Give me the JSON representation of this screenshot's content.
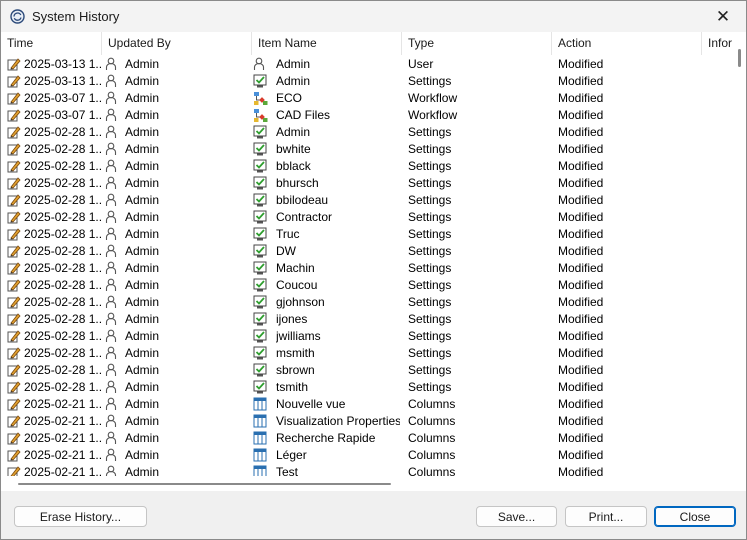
{
  "window": {
    "title": "System History"
  },
  "columns": [
    "Time",
    "Updated By",
    "Item Name",
    "Type",
    "Action",
    "Infor"
  ],
  "rows": [
    {
      "time": "2025-03-13 1...",
      "user": "Admin",
      "item": "Admin",
      "item_icon": "user",
      "type": "User",
      "action": "Modified"
    },
    {
      "time": "2025-03-13 1...",
      "user": "Admin",
      "item": "Admin",
      "item_icon": "settings",
      "type": "Settings",
      "action": "Modified"
    },
    {
      "time": "2025-03-07 1...",
      "user": "Admin",
      "item": "ECO",
      "item_icon": "workflow",
      "type": "Workflow",
      "action": "Modified"
    },
    {
      "time": "2025-03-07 1...",
      "user": "Admin",
      "item": "CAD Files",
      "item_icon": "workflow",
      "type": "Workflow",
      "action": "Modified"
    },
    {
      "time": "2025-02-28 1...",
      "user": "Admin",
      "item": "Admin",
      "item_icon": "settings",
      "type": "Settings",
      "action": "Modified"
    },
    {
      "time": "2025-02-28 1...",
      "user": "Admin",
      "item": "bwhite",
      "item_icon": "settings",
      "type": "Settings",
      "action": "Modified"
    },
    {
      "time": "2025-02-28 1...",
      "user": "Admin",
      "item": "bblack",
      "item_icon": "settings",
      "type": "Settings",
      "action": "Modified"
    },
    {
      "time": "2025-02-28 1...",
      "user": "Admin",
      "item": "bhursch",
      "item_icon": "settings",
      "type": "Settings",
      "action": "Modified"
    },
    {
      "time": "2025-02-28 1...",
      "user": "Admin",
      "item": "bbilodeau",
      "item_icon": "settings",
      "type": "Settings",
      "action": "Modified"
    },
    {
      "time": "2025-02-28 1...",
      "user": "Admin",
      "item": "Contractor",
      "item_icon": "settings",
      "type": "Settings",
      "action": "Modified"
    },
    {
      "time": "2025-02-28 1...",
      "user": "Admin",
      "item": "Truc",
      "item_icon": "settings",
      "type": "Settings",
      "action": "Modified"
    },
    {
      "time": "2025-02-28 1...",
      "user": "Admin",
      "item": "DW",
      "item_icon": "settings",
      "type": "Settings",
      "action": "Modified"
    },
    {
      "time": "2025-02-28 1...",
      "user": "Admin",
      "item": "Machin",
      "item_icon": "settings",
      "type": "Settings",
      "action": "Modified"
    },
    {
      "time": "2025-02-28 1...",
      "user": "Admin",
      "item": "Coucou",
      "item_icon": "settings",
      "type": "Settings",
      "action": "Modified"
    },
    {
      "time": "2025-02-28 1...",
      "user": "Admin",
      "item": "gjohnson",
      "item_icon": "settings",
      "type": "Settings",
      "action": "Modified"
    },
    {
      "time": "2025-02-28 1...",
      "user": "Admin",
      "item": "ijones",
      "item_icon": "settings",
      "type": "Settings",
      "action": "Modified"
    },
    {
      "time": "2025-02-28 1...",
      "user": "Admin",
      "item": "jwilliams",
      "item_icon": "settings",
      "type": "Settings",
      "action": "Modified"
    },
    {
      "time": "2025-02-28 1...",
      "user": "Admin",
      "item": "msmith",
      "item_icon": "settings",
      "type": "Settings",
      "action": "Modified"
    },
    {
      "time": "2025-02-28 1...",
      "user": "Admin",
      "item": "sbrown",
      "item_icon": "settings",
      "type": "Settings",
      "action": "Modified"
    },
    {
      "time": "2025-02-28 1...",
      "user": "Admin",
      "item": "tsmith",
      "item_icon": "settings",
      "type": "Settings",
      "action": "Modified"
    },
    {
      "time": "2025-02-21 1...",
      "user": "Admin",
      "item": "Nouvelle vue",
      "item_icon": "columns",
      "type": "Columns",
      "action": "Modified"
    },
    {
      "time": "2025-02-21 1...",
      "user": "Admin",
      "item": "Visualization Properties ...",
      "item_icon": "columns",
      "type": "Columns",
      "action": "Modified"
    },
    {
      "time": "2025-02-21 1...",
      "user": "Admin",
      "item": "Recherche Rapide",
      "item_icon": "columns",
      "type": "Columns",
      "action": "Modified"
    },
    {
      "time": "2025-02-21 1...",
      "user": "Admin",
      "item": "Léger",
      "item_icon": "columns",
      "type": "Columns",
      "action": "Modified"
    },
    {
      "time": "2025-02-21 1...",
      "user": "Admin",
      "item": "Test",
      "item_icon": "columns",
      "type": "Columns",
      "action": "Modified"
    }
  ],
  "buttons": {
    "erase": "Erase History...",
    "save": "Save...",
    "print": "Print...",
    "close": "Close"
  },
  "colors": {
    "accent": "#0067c0",
    "check_green": "#2e9e2e"
  }
}
